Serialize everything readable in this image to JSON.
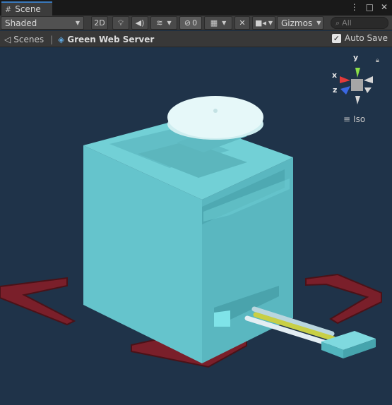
{
  "window": {
    "tab_label": "Scene"
  },
  "toolbar": {
    "shading_mode": "Shaded",
    "toggle_2d": "2D",
    "hidden_count": "0",
    "gizmos_label": "Gizmos",
    "search_placeholder": "All"
  },
  "breadcrumb": {
    "root_label": "Scenes",
    "separator": "|",
    "current_label": "Green Web Server"
  },
  "autosave": {
    "label": "Auto Save",
    "checked": true
  },
  "orientation_gizmo": {
    "y_label": "y",
    "x_label": "x",
    "z_label": "z",
    "projection_label": "Iso"
  },
  "colors": {
    "scene_background": "#1f3349",
    "object_cyan": "#62c3cb",
    "selection_red": "#7a1f2a",
    "tab_accent": "#3a79bb"
  }
}
